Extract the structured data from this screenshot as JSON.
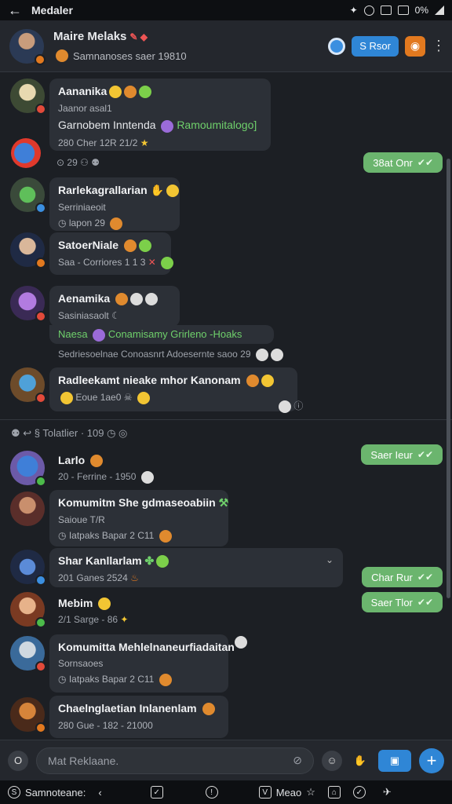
{
  "statusbar": {
    "title": "Medaler",
    "battery": "0%"
  },
  "header": {
    "name": "Maire Melaks",
    "subtitle": "Samnanoses saer 19810",
    "pill_label": "S Rsor"
  },
  "messages": [
    {
      "name": "Aananika",
      "line1": "Jaanor asal1",
      "line2": "Garnobem Inntenda",
      "line2_green": "Ramoumitalogo]",
      "line3": "280 Cher 12R 21/2",
      "reactions": "29"
    },
    {
      "name": "Rarlekagrallarian",
      "line1": "Serriniaeoit",
      "line2": "lapon 29"
    },
    {
      "name": "SatoerNiale",
      "line1": "Saa - Corriores 1 1 3"
    },
    {
      "name": "Aenamika",
      "line1": "Sasiniasaolt",
      "line2": "Naesa",
      "line2_green": "Conamisamy Grirleno -Hoaks",
      "line3": "Sedriesoelnae Conoasnrt Adoesernte saoo 29"
    },
    {
      "name": "Radleekamt nieake mhor Kanonam",
      "line1": "Eoue 1ae0"
    },
    {
      "name": "Larlo",
      "line1": "20 - Ferrine - 1950"
    },
    {
      "name": "Komumitm She gdmaseoabiin",
      "line1": "Saioue T/R",
      "line2": "Iatpaks Bapar 2 C11"
    },
    {
      "name": "Shar Kanllarlam",
      "line1": "201 Ganes 2524"
    },
    {
      "name": "Mebim",
      "line1": "2/1 Sarge - 86"
    },
    {
      "name": "Komumitta Mehlelnaneurfiadaitan",
      "line1": "Sornsaoes",
      "line2": "Iatpaks Bapar 2 C11"
    },
    {
      "name": "Chaelnglaetian Inlanenlam",
      "line1": "280 Gue - 182 - 21000"
    }
  ],
  "sent": [
    {
      "label": "38at Onr"
    },
    {
      "label": "Saer Ieur"
    },
    {
      "label": "Char Rur"
    },
    {
      "label": "Saer Tlor"
    }
  ],
  "date_divider": "Tolatlier · 109",
  "composer": {
    "placeholder": "Mat Reklaane."
  },
  "navbar": {
    "left_label": "Samnoteane:",
    "mid_label": "Meao"
  }
}
